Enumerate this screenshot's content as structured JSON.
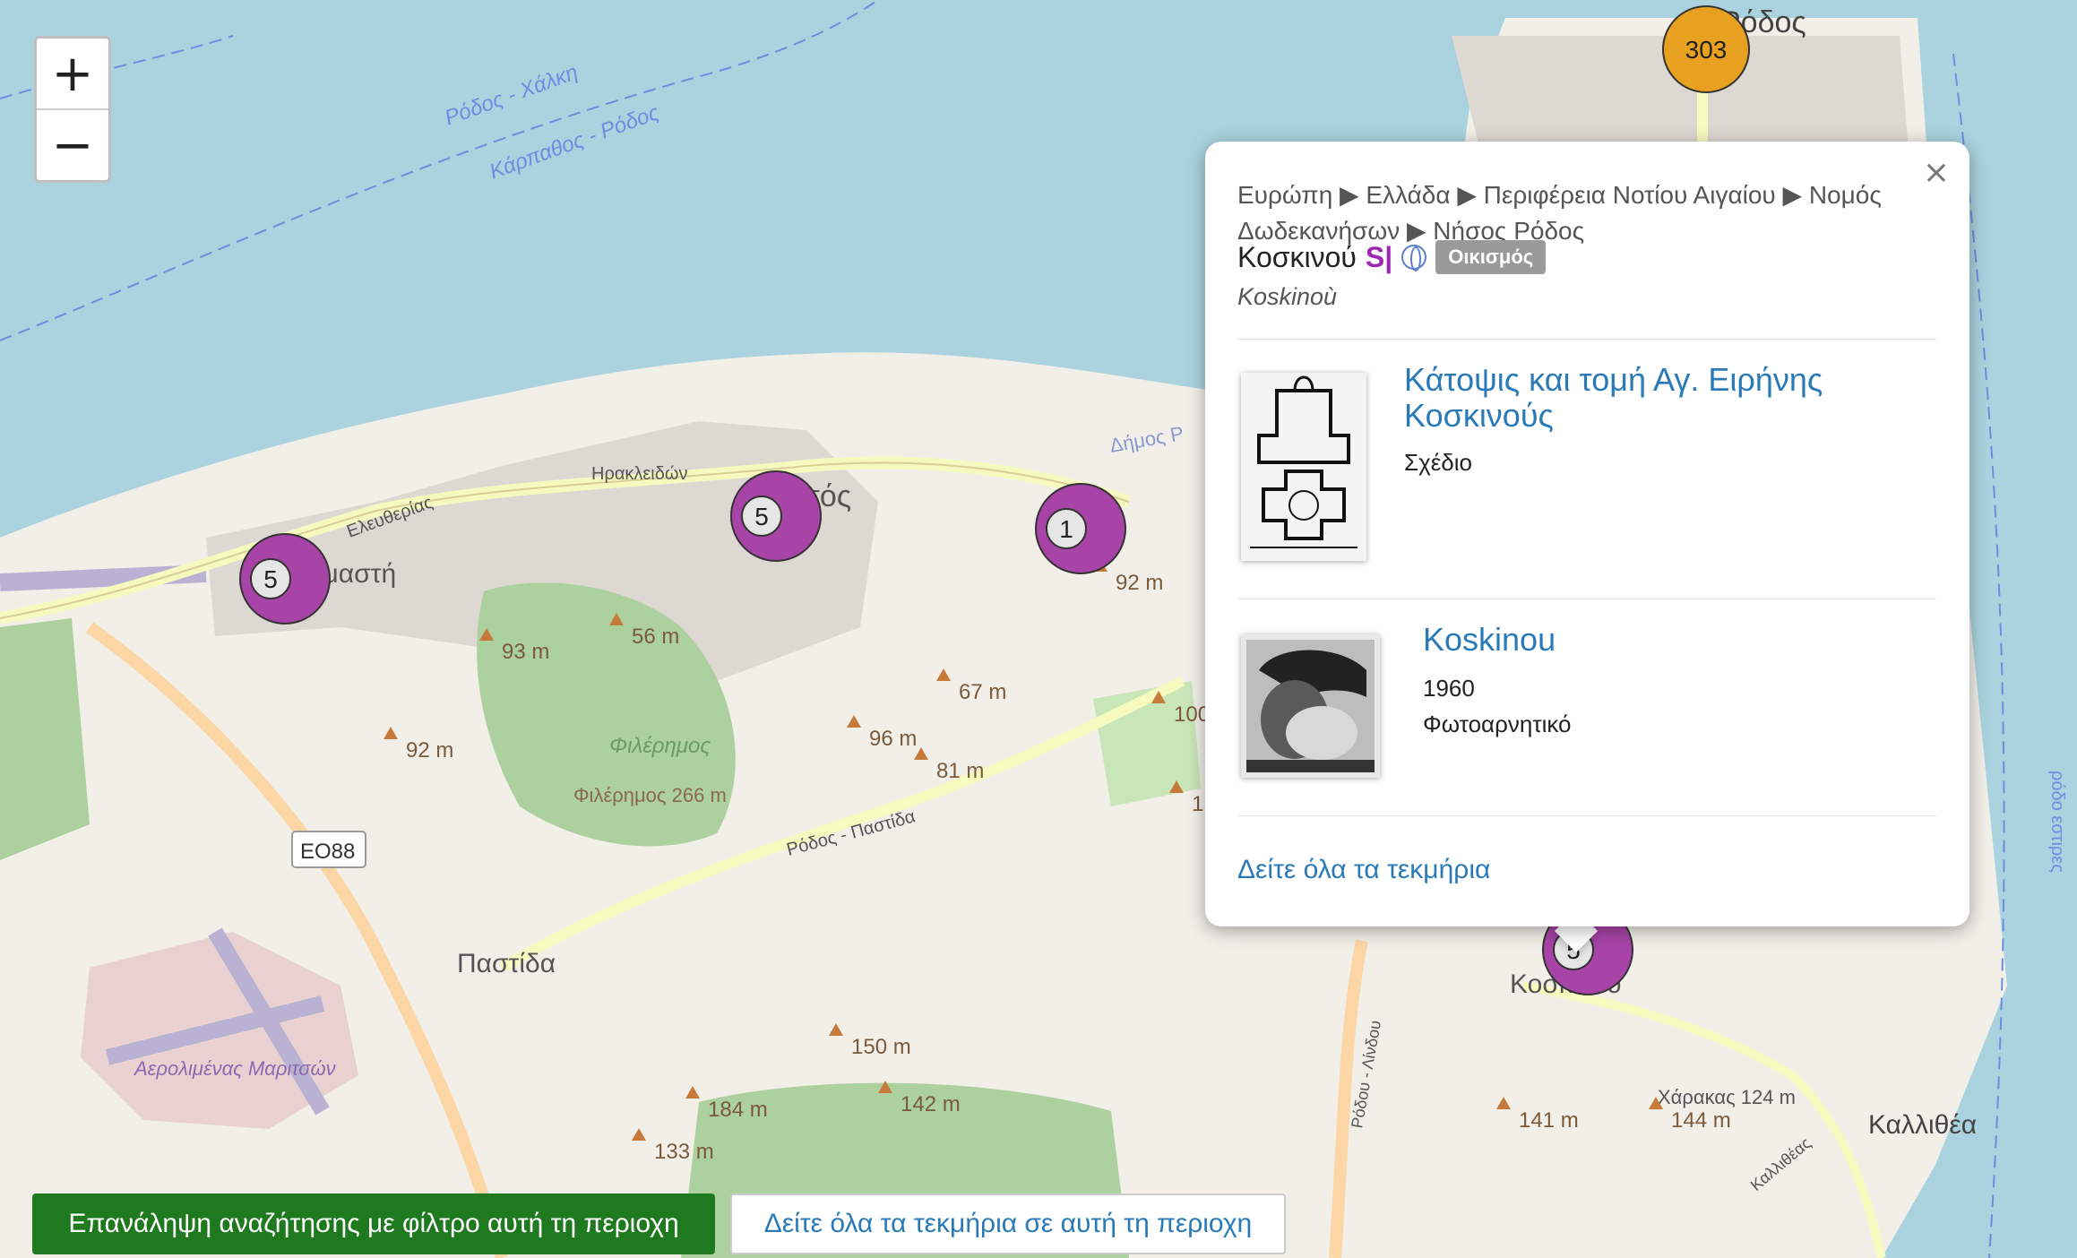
{
  "map": {
    "labels": {
      "sea_route_1": "Ρόδος - Χάλκη",
      "sea_route_2": "Κάρπαθος - Ρόδος",
      "town_ialysos": "Ιαλυσός",
      "town_kremasti": "Κρεμαστή",
      "town_pastida": "Παστίδα",
      "town_koskinou": "Κοσκινού",
      "town_kallithea": "Καλλιθέα",
      "city_rodos": "Ρόδος",
      "airport": "Αερολιμένας Μαριτσών",
      "mountain": "Φιλέρημος",
      "mountain_peak": "Φιλέρημος 266 m",
      "road_eo88": "ΕΟ88",
      "road_herakleidon": "Ηρακλειδών",
      "road_eleftherias": "Ελευθερίας",
      "road_rodos_pastida": "Ρόδος - Παστίδα",
      "road_kallitheas": "Καλλιθέας",
      "road_rodou_lindou": "Ρόδου - Λίνδου",
      "dimos": "Δήμος Ρ",
      "harakas": "Χάρακας 124 m",
      "side_text": "ρόδο εστιρες"
    },
    "elevations": [
      "93 m",
      "56 m",
      "92 m",
      "67 m",
      "96 m",
      "81 m",
      "92 m",
      "150 m",
      "184 m",
      "142 m",
      "133 m",
      "141 m",
      "144 m",
      "100",
      "1"
    ],
    "clusters": [
      {
        "count": "303",
        "color": "#e8a020"
      },
      {
        "count": "5",
        "color": "#a844a8"
      },
      {
        "count": "5",
        "color": "#a844a8"
      },
      {
        "count": "1",
        "color": "#a844a8"
      },
      {
        "count": "5",
        "color": "#a844a8"
      }
    ]
  },
  "zoom": {
    "in": "+",
    "out": "−"
  },
  "popup": {
    "close": "×",
    "breadcrumb": "Ευρώπη ▶ Ελλάδα ▶ Περιφέρεια Νοτίου Αιγαίου ▶ Νομός Δωδεκανήσων ▶ Νήσος Ρόδος",
    "place_name": "Κοσκινού",
    "s_icon": "S|",
    "badge": "Οικισμός",
    "latin_name": "Koskinoù",
    "items": [
      {
        "title": "Κάτοψις και τομή Αγ. Ειρήνης Κοσκινούς",
        "line1": "Σχέδιο",
        "line2": ""
      },
      {
        "title": "Koskinou",
        "line1": "1960",
        "line2": "Φωτοαρνητικό"
      }
    ],
    "see_all": "Δείτε όλα τα τεκμήρια"
  },
  "buttons": {
    "repeat_search": "Επανάληψη αναζήτησης με φίλτρο αυτή τη περιοχη",
    "see_all_area": "Δείτε όλα τα τεκμήρια σε αυτή τη περιοχη"
  }
}
